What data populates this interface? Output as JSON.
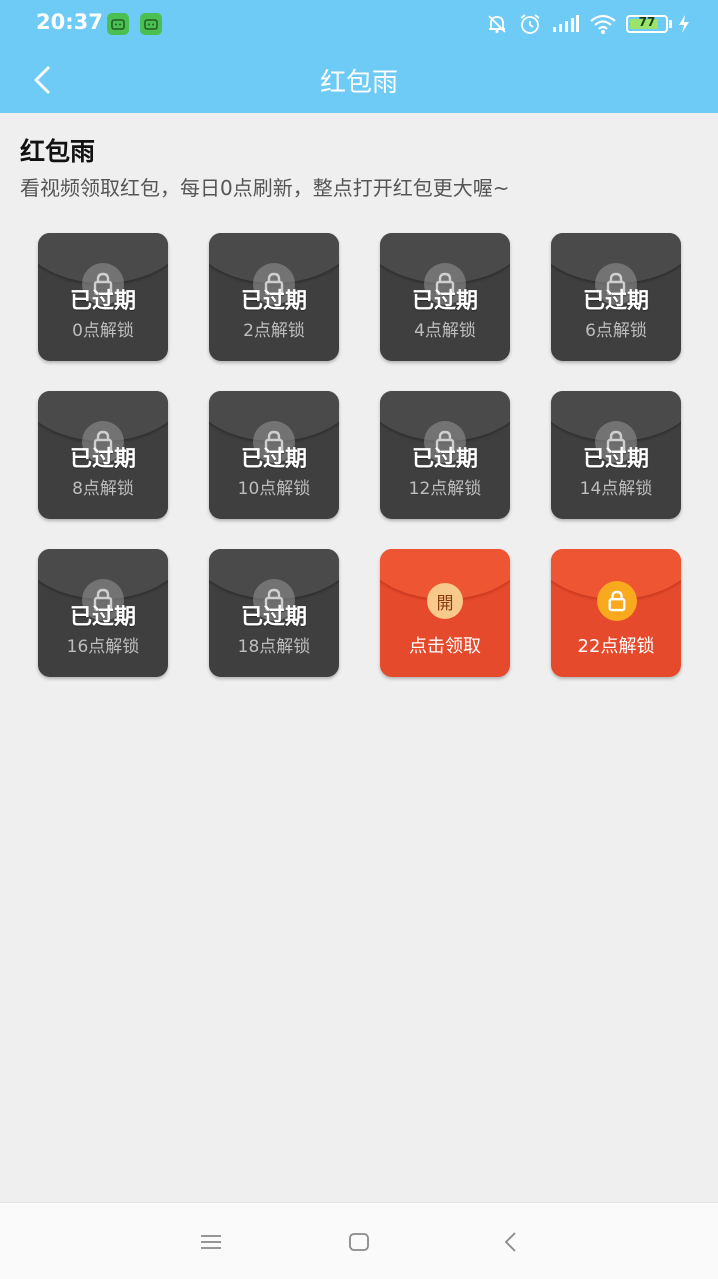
{
  "status_bar": {
    "time": "20:37",
    "battery": "77",
    "icons": [
      "app-notification-icon",
      "app-notification-icon",
      "mute-bell-icon",
      "alarm-icon",
      "signal-icon",
      "wifi-icon",
      "battery-icon",
      "charging-icon"
    ]
  },
  "nav": {
    "title": "红包雨",
    "back_icon": "back-arrow-icon"
  },
  "header": {
    "title": "红包雨",
    "subtitle": "看视频领取红包，每日0点刷新，整点打开红包更大喔~"
  },
  "cards": [
    {
      "state": "已过期",
      "label": "0点解锁",
      "style": "expired"
    },
    {
      "state": "已过期",
      "label": "2点解锁",
      "style": "expired"
    },
    {
      "state": "已过期",
      "label": "4点解锁",
      "style": "expired"
    },
    {
      "state": "已过期",
      "label": "6点解锁",
      "style": "expired"
    },
    {
      "state": "已过期",
      "label": "8点解锁",
      "style": "expired"
    },
    {
      "state": "已过期",
      "label": "10点解锁",
      "style": "expired"
    },
    {
      "state": "已过期",
      "label": "12点解锁",
      "style": "expired"
    },
    {
      "state": "已过期",
      "label": "14点解锁",
      "style": "expired"
    },
    {
      "state": "已过期",
      "label": "16点解锁",
      "style": "expired"
    },
    {
      "state": "已过期",
      "label": "18点解锁",
      "style": "expired"
    },
    {
      "badge": "開",
      "label": "点击领取",
      "style": "open"
    },
    {
      "label": "22点解锁",
      "style": "locked"
    }
  ],
  "colors": {
    "topbar": "#6ecbf5",
    "card_dark": "#3f3f3f",
    "card_red": "#e64a2c",
    "lock_gold": "#f8a91e"
  },
  "system_nav": {
    "icons": [
      "menu-icon",
      "home-square-icon",
      "back-chevron-icon"
    ]
  }
}
